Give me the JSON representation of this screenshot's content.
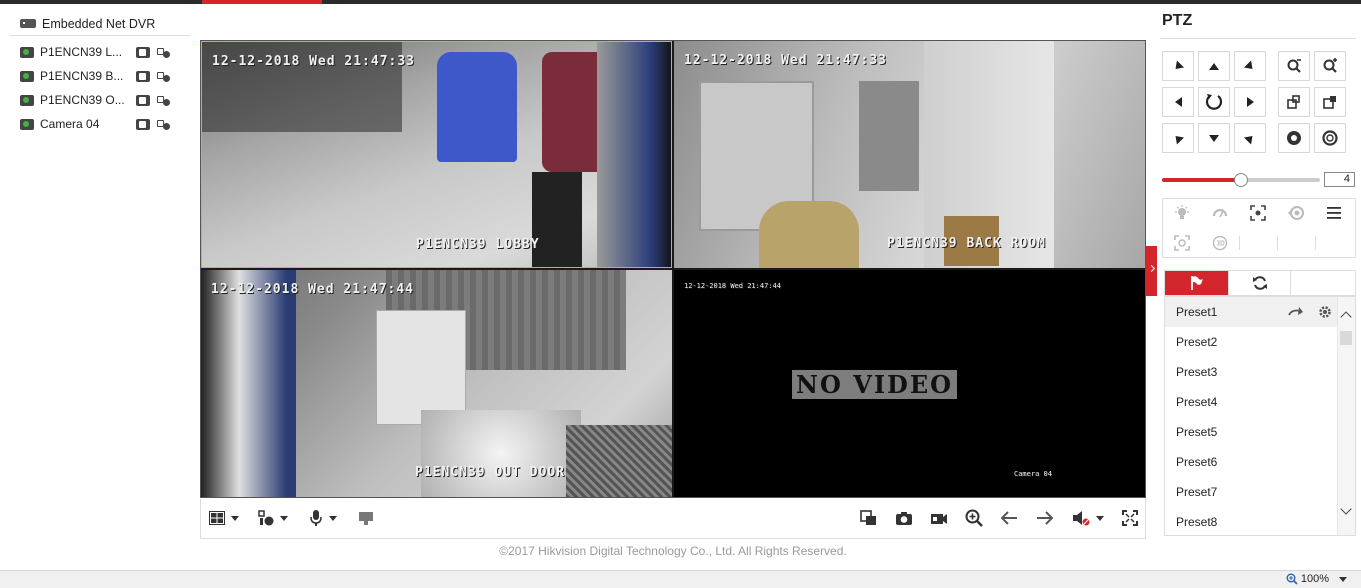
{
  "tree": {
    "root_label": "Embedded Net DVR",
    "cameras": [
      {
        "label": "P1ENCN39 L..."
      },
      {
        "label": "P1ENCN39 B..."
      },
      {
        "label": "P1ENCN39 O..."
      },
      {
        "label": "Camera 04"
      }
    ]
  },
  "video": {
    "panes": [
      {
        "timestamp": "12-12-2018 Wed 21:47:33",
        "camera_name": "P1ENCN39 LOBBY"
      },
      {
        "timestamp": "12-12-2018 Wed 21:47:33",
        "camera_name": "P1ENCN39 BACK ROOM"
      },
      {
        "timestamp": "12-12-2018 Wed 21:47:44",
        "camera_name": "P1ENCN39 OUT DOOR"
      },
      {
        "timestamp": "12-12-2018 Wed 21:47:44",
        "camera_name": "Camera 04",
        "overlay": "NO VIDEO"
      }
    ]
  },
  "toolbar": {
    "left_icons": [
      "layout-grid-icon",
      "ptz-control-icon",
      "microphone-icon",
      "alarm-output-icon"
    ],
    "right_icons": [
      "capture-all-icon",
      "snapshot-icon",
      "record-icon",
      "digital-zoom-icon",
      "previous-page-icon",
      "next-page-icon",
      "mute-icon",
      "fullscreen-icon"
    ]
  },
  "footer": {
    "text": "©2017 Hikvision Digital Technology Co., Ltd. All Rights Reserved."
  },
  "ptz": {
    "title": "PTZ",
    "speed_value": "4",
    "speed_level": 0.5,
    "presets": [
      {
        "label": "Preset1"
      },
      {
        "label": "Preset2"
      },
      {
        "label": "Preset3"
      },
      {
        "label": "Preset4"
      },
      {
        "label": "Preset5"
      },
      {
        "label": "Preset6"
      },
      {
        "label": "Preset7"
      },
      {
        "label": "Preset8"
      }
    ]
  },
  "status": {
    "zoom": "100%"
  },
  "colors": {
    "accent": "#d3262c",
    "selected_pane_border": "#e6a92a"
  }
}
